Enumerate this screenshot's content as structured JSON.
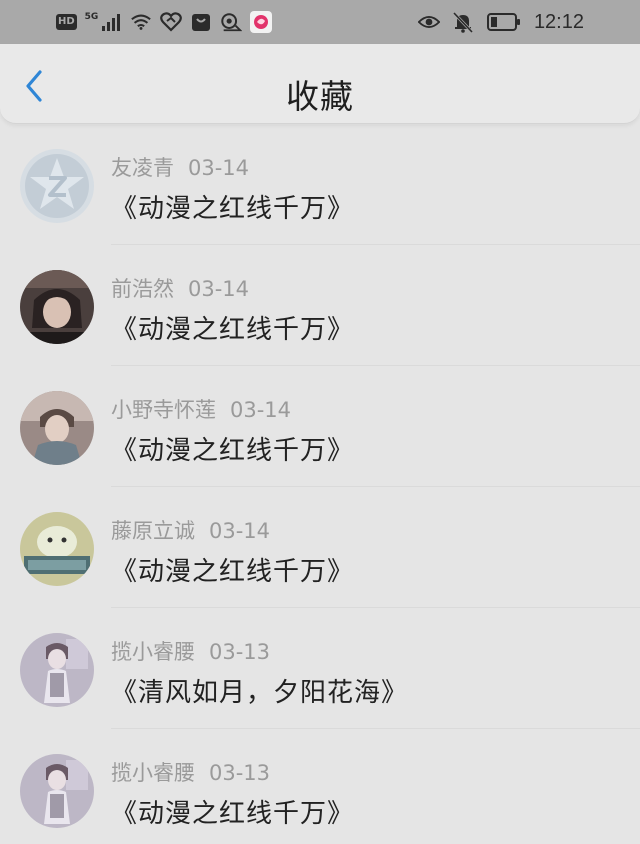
{
  "status_bar": {
    "hd_label": "HD",
    "network_label": "5G",
    "time": "12:12"
  },
  "header": {
    "title": "收藏"
  },
  "items": [
    {
      "user": "友凌青",
      "date": "03-14",
      "work": "《动漫之红线千万》"
    },
    {
      "user": "前浩然",
      "date": "03-14",
      "work": "《动漫之红线千万》"
    },
    {
      "user": "小野寺怀莲",
      "date": "03-14",
      "work": "《动漫之红线千万》"
    },
    {
      "user": "藤原立诚",
      "date": "03-14",
      "work": "《动漫之红线千万》"
    },
    {
      "user": "揽小睿腰",
      "date": "03-13",
      "work": "《清风如月，夕阳花海》"
    },
    {
      "user": "揽小睿腰",
      "date": "03-13",
      "work": "《动漫之红线千万》"
    }
  ],
  "colors": {
    "accent": "#2f86d6",
    "status_bar_bg": "#a9a9a9",
    "page_bg": "#e5e5e5"
  }
}
